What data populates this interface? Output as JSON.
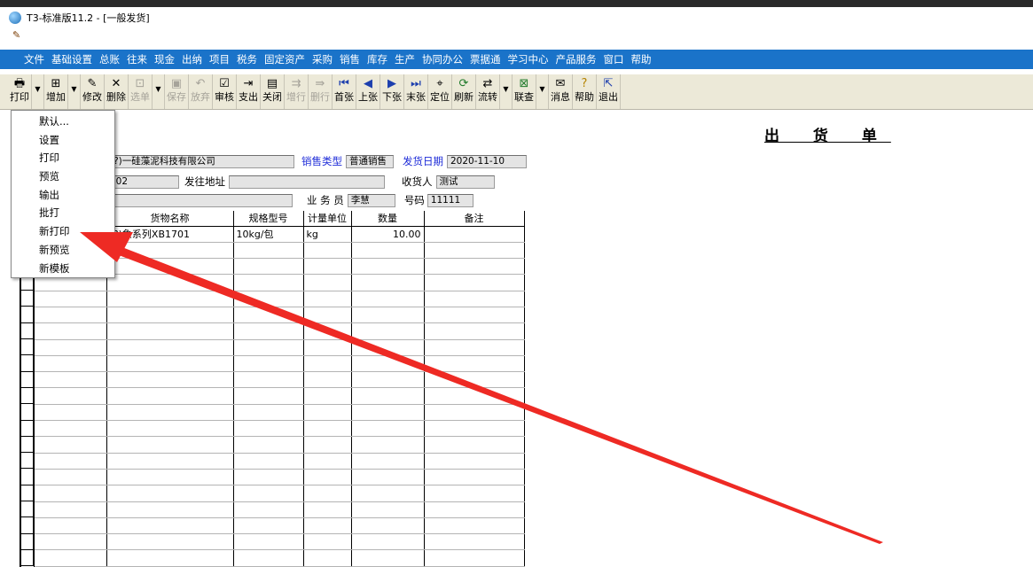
{
  "window": {
    "title": "T3-标准版11.2 - [一般发货]"
  },
  "menu": [
    "文件",
    "基础设置",
    "总账",
    "往来",
    "现金",
    "出纳",
    "项目",
    "税务",
    "固定资产",
    "采购",
    "销售",
    "库存",
    "生产",
    "协同办公",
    "票据通",
    "学习中心",
    "产品服务",
    "窗口",
    "帮助"
  ],
  "toolbar": {
    "print": "打印",
    "add": "增加",
    "modify": "修改",
    "delete": "删除",
    "select": "选单",
    "save": "保存",
    "discard": "放弃",
    "audit": "审核",
    "payout": "支出",
    "close": "关闭",
    "addrow": "增行",
    "delrow": "删行",
    "first": "首张",
    "prev": "上张",
    "next": "下张",
    "last": "末张",
    "locate": "定位",
    "refresh": "刷新",
    "flow": "流转",
    "linked": "联查",
    "message": "消息",
    "help": "帮助",
    "exit": "退出"
  },
  "icons": {
    "print": "printer-icon",
    "add": "add-doc-icon",
    "modify": "edit-icon",
    "delete": "delete-x-icon",
    "audit": "audit-icon",
    "first": "first-icon",
    "prev": "prev-icon",
    "next": "next-icon",
    "last": "last-icon"
  },
  "print_menu": [
    "默认...",
    "设置",
    "打印",
    "预览",
    "输出",
    "批打",
    "新打印",
    "新预览",
    "新模板"
  ],
  "document": {
    "title": "出 货 单",
    "customer_value": "(?)一硅藻泥科技有限公司",
    "sales_type_label": "销售类型",
    "sales_type_value": "普通销售",
    "ship_date_label": "发货日期",
    "ship_date_value": "2020-11-10",
    "code_value": "002",
    "ship_address_label": "发往地址",
    "ship_address_value": "",
    "receiver_label": "收货人",
    "receiver_value": "测试",
    "salesperson_label": "业 务 员",
    "salesperson_value": "李慧",
    "number_label": "号码",
    "number_value": "11111"
  },
  "grid": {
    "columns": [
      "",
      "货物名称",
      "规格型号",
      "计量单位",
      "数量",
      "备注"
    ],
    "rows": [
      [
        "",
        "(?)象系列XB1701",
        "10kg/包",
        "kg",
        "10.00",
        ""
      ]
    ]
  },
  "colors": {
    "menubar": "#1a73c9",
    "label_blue": "#1d2bd8",
    "annotation_arrow": "#ee2a24"
  }
}
